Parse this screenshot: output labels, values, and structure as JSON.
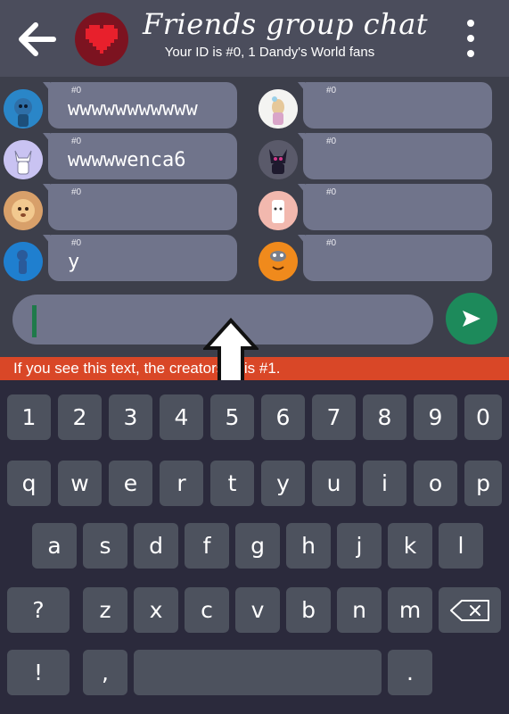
{
  "header": {
    "title": "Friends group chat",
    "subtitle": "Your ID is #0, 1 Dandy's World fans"
  },
  "messages": [
    {
      "sender_id": "#0",
      "text": "wwwwwwwwwww"
    },
    {
      "sender_id": "#0",
      "text": ""
    },
    {
      "sender_id": "#0",
      "text": "wwwwwenca6"
    },
    {
      "sender_id": "#0",
      "text": ""
    },
    {
      "sender_id": "#0",
      "text": ""
    },
    {
      "sender_id": "#0",
      "text": ""
    },
    {
      "sender_id": "#0",
      "text": "y"
    },
    {
      "sender_id": "#0",
      "text": ""
    }
  ],
  "composer": {
    "value": ""
  },
  "banner": {
    "text": "If you see this text, the creators id is #1."
  },
  "keyboard": {
    "row1": [
      "1",
      "2",
      "3",
      "4",
      "5",
      "6",
      "7",
      "8",
      "9",
      "0"
    ],
    "row2": [
      "q",
      "w",
      "e",
      "r",
      "t",
      "y",
      "u",
      "i",
      "o",
      "p"
    ],
    "row3": [
      "a",
      "s",
      "d",
      "f",
      "g",
      "h",
      "j",
      "k",
      "l"
    ],
    "row4": [
      "?",
      "z",
      "x",
      "c",
      "v",
      "b",
      "n",
      "m"
    ],
    "row5": [
      "!",
      ",",
      "",
      "."
    ]
  },
  "colors": {
    "header_bg": "#4b4d5c",
    "chat_bg": "#3d3f4b",
    "bubble": "#70748b",
    "send_button": "#1d8a5b",
    "banner": "#d94727",
    "keyboard_bg": "#2b2a3c",
    "key": "#4d525e"
  },
  "icons": {
    "back": "arrow-left-icon",
    "logo": "pixel-heart-icon",
    "menu": "more-vertical-icon",
    "send": "send-arrow-icon",
    "backspace": "backspace-icon"
  }
}
